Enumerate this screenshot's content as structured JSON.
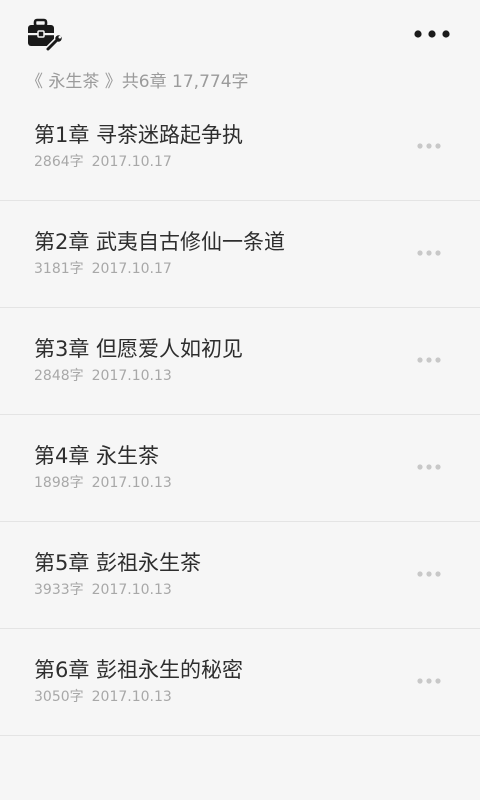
{
  "toolbar": {
    "left_icon": "toolbox-icon",
    "right_icon": "more-horizontal-icon"
  },
  "summary": {
    "book_title": "《 永生茶 》",
    "stats": "共6章 17,774字"
  },
  "chapters": [
    {
      "title": "第1章 寻茶迷路起争执",
      "word_count": "2864字",
      "date": "2017.10.17"
    },
    {
      "title": "第2章 武夷自古修仙一条道",
      "word_count": "3181字",
      "date": "2017.10.17"
    },
    {
      "title": "第3章 但愿爱人如初见",
      "word_count": "2848字",
      "date": "2017.10.13"
    },
    {
      "title": "第4章 永生茶",
      "word_count": "1898字",
      "date": "2017.10.13"
    },
    {
      "title": "第5章 彭祖永生茶",
      "word_count": "3933字",
      "date": "2017.10.13"
    },
    {
      "title": "第6章 彭祖永生的秘密",
      "word_count": "3050字",
      "date": "2017.10.13"
    }
  ],
  "colors": {
    "background": "#f6f6f6",
    "divider": "#e4e4e4",
    "title_text": "#2e2e2e",
    "meta_text": "#a8a8a8",
    "row_more_dots": "#c8c8c8"
  }
}
